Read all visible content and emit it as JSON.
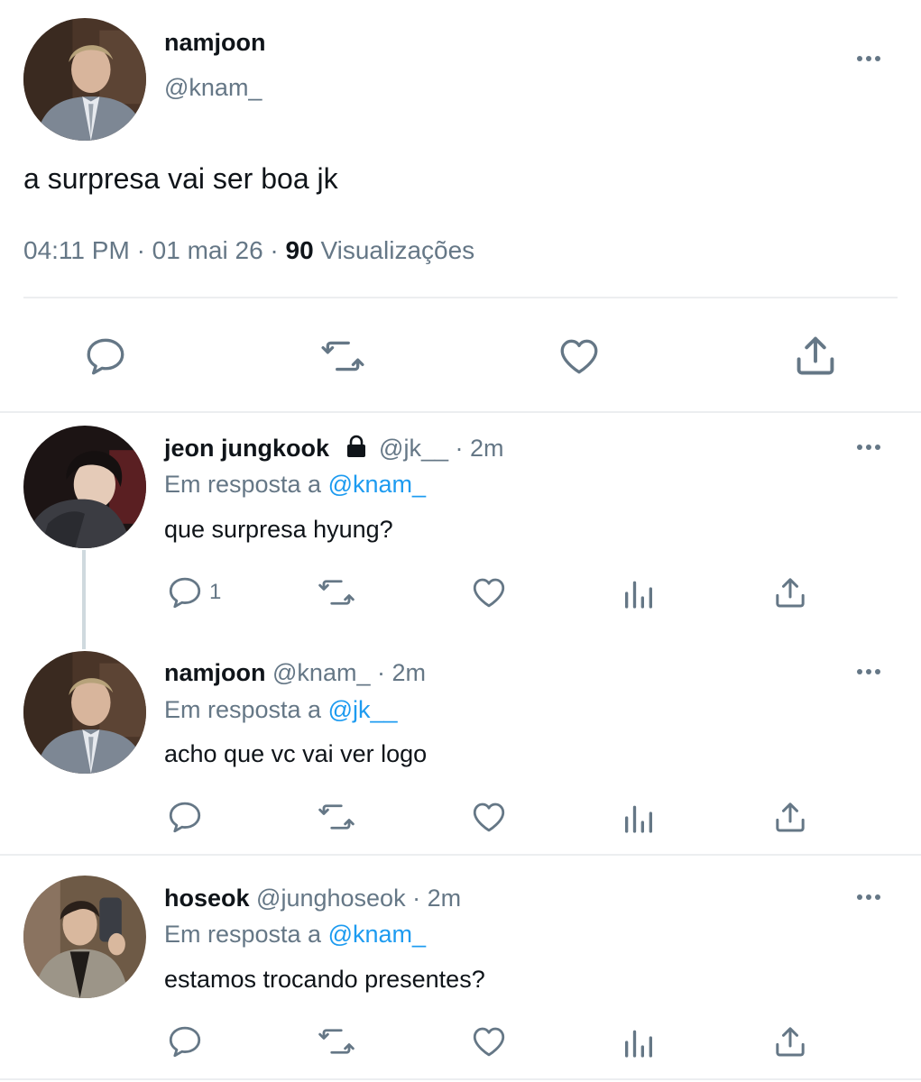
{
  "main_tweet": {
    "author_name": "namjoon",
    "handle": "@knam_",
    "text": "a surpresa vai ser boa jk",
    "time": "04:11 PM",
    "date": "01 mai 26",
    "views_count": "90",
    "views_label": "Visualizações"
  },
  "replies": [
    {
      "author_name": "jeon jungkook",
      "locked": true,
      "handle": "@jk__",
      "time": "2m",
      "reply_prefix": "Em resposta a",
      "reply_to": "@knam_",
      "text": "que surpresa hyung?",
      "reply_count": "1"
    },
    {
      "author_name": "namjoon",
      "handle": "@knam_",
      "time": "2m",
      "reply_prefix": "Em resposta a",
      "reply_to": "@jk__",
      "text": "acho que vc vai ver logo",
      "reply_count": ""
    },
    {
      "author_name": "hoseok",
      "handle": "@junghoseok",
      "time": "2m",
      "reply_prefix": "Em resposta a",
      "reply_to": "@knam_",
      "text": "estamos trocando presentes?",
      "reply_count": ""
    }
  ],
  "separator": "·",
  "icons": {
    "reply": "reply-icon",
    "retweet": "retweet-icon",
    "like": "heart-icon",
    "analytics": "analytics-icon",
    "share": "share-icon",
    "more": "more-icon",
    "lock": "lock-icon"
  },
  "colors": {
    "text": "#0f1419",
    "secondary": "#657786",
    "link": "#1d9bf0",
    "divider": "#eceef0"
  }
}
